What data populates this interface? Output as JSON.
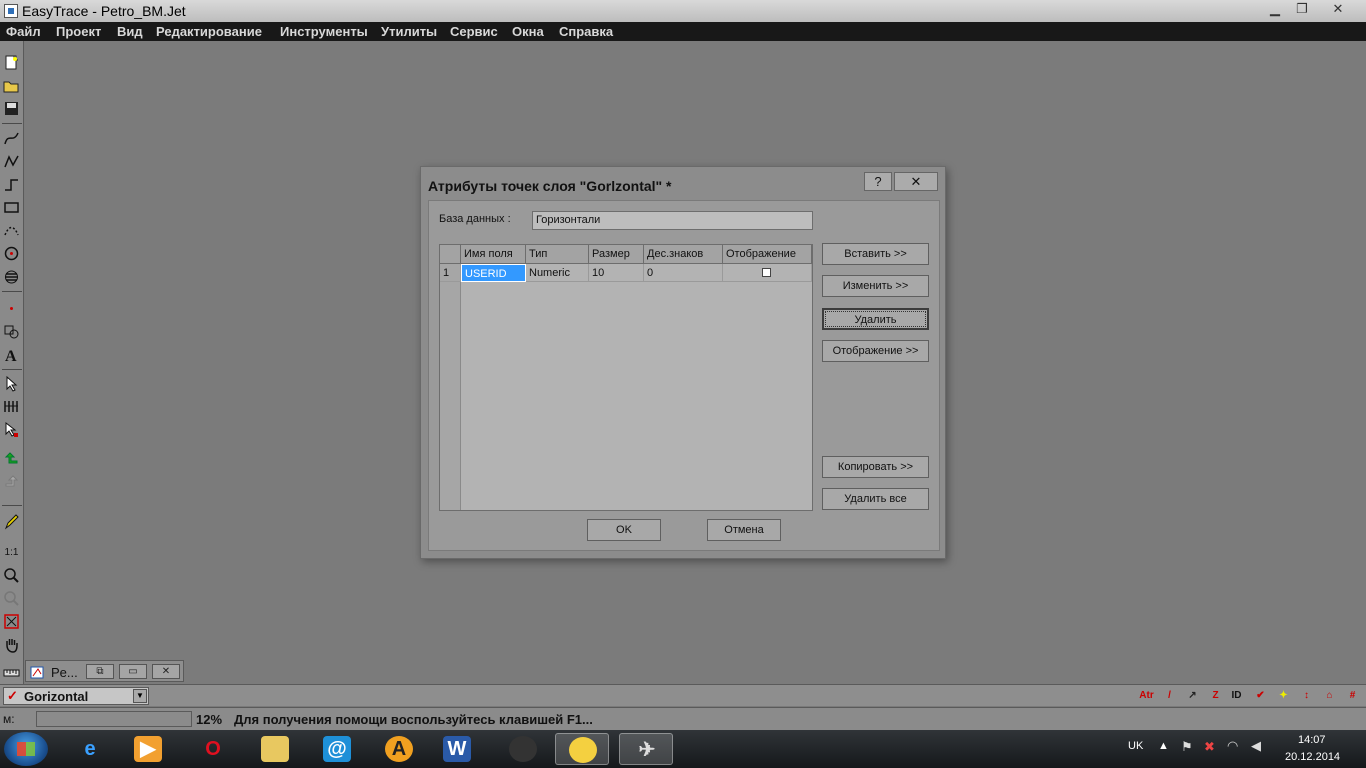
{
  "window": {
    "title": "EasyTrace - Petro_BM.Jet",
    "minimize": "▁",
    "restore": "❐",
    "close": "✕"
  },
  "menu": [
    "Файл",
    "Проект",
    "Вид",
    "Редактирование",
    "Инструменты",
    "Утилиты",
    "Сервис",
    "Окна",
    "Справка"
  ],
  "dialog": {
    "title": "Атрибуты точек слоя \"Gorlzontal\" *",
    "help": "?",
    "close": "✕",
    "db_label": "База данных :",
    "db_value": "Горизонтали",
    "columns": [
      "Имя поля",
      "Тип",
      "Размер",
      "Дес.знаков",
      "Отображение"
    ],
    "rows": [
      {
        "num": "1",
        "name": "USERID",
        "type": "Numeric",
        "size": "10",
        "dec": "0",
        "display": false
      }
    ],
    "buttons": {
      "insert": "Вставить >>",
      "modify": "Изменить >>",
      "delete": "Удалить",
      "display": "Отображение >>",
      "copy": "Копировать >>",
      "delete_all": "Удалить все",
      "ok": "OK",
      "cancel": "Отмена"
    }
  },
  "mdi_tab": {
    "label": "Pe..."
  },
  "layer": {
    "name": "Gorizontal"
  },
  "statusbar": {
    "m_label": "м:",
    "zoom": "12%",
    "message": "Для получения помощи воспользуйтесь клавишей F1..."
  },
  "taskbar": {
    "lang": "UK",
    "time": "14:07",
    "date": "20.12.2014"
  },
  "layer_tools": [
    "Atr",
    "/",
    "↗",
    "Z",
    "ID",
    "✔",
    "✦",
    "↕",
    "⌂",
    "#"
  ]
}
